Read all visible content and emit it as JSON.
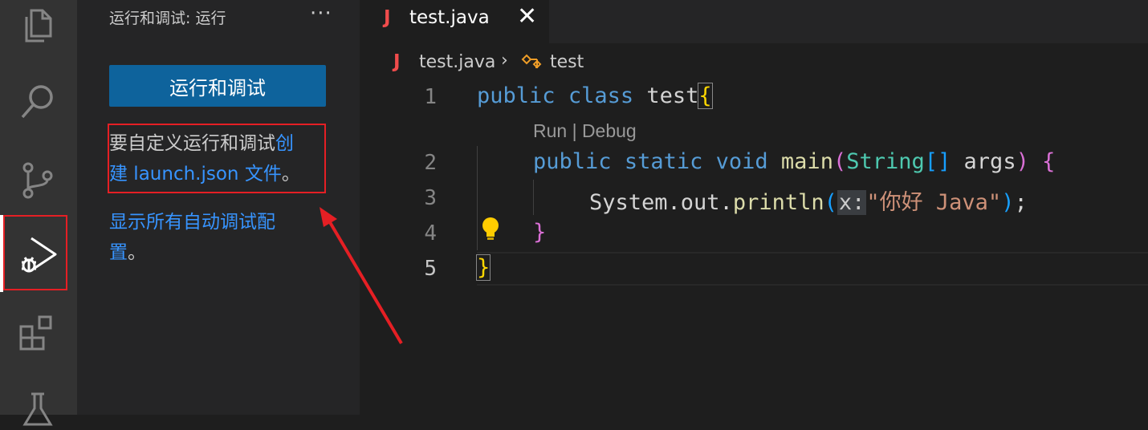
{
  "sidebar": {
    "title": "运行和调试: 运行",
    "more": "···",
    "run_button": "运行和调试",
    "hint_prefix": "要自定义运行和调试",
    "hint_link_1": "创",
    "hint_link_2": "建 launch.json 文件",
    "hint_suffix": "。",
    "show_all_line1": "显示所有自动调试配",
    "show_all_line2": "置",
    "show_all_suffix": "。"
  },
  "tabs": [
    {
      "icon": "J",
      "label": "test.java",
      "close": "✕"
    }
  ],
  "breadcrumb": {
    "icon": "J",
    "file": "test.java",
    "separator": "›",
    "class": "test"
  },
  "editor": {
    "codelens": "Run | Debug",
    "line_numbers": [
      "1",
      "2",
      "3",
      "4",
      "5"
    ],
    "line1": {
      "kw1": "public",
      "kw2": "class",
      "name": "test",
      "brace": "{"
    },
    "line2": {
      "kw1": "public",
      "kw2": "static",
      "kw3": "void",
      "fn": "main",
      "p_open": "(",
      "type": "String",
      "arr": "[]",
      "arg": "args",
      "p_close": ")",
      "brace": "{"
    },
    "line3": {
      "obj": "System.out.",
      "fn": "println",
      "p_open": "(",
      "param_hint": "x:",
      "str": "\"你好 Java\"",
      "p_close": ")",
      "semi": ";"
    },
    "line4": {
      "brace": "}"
    },
    "line5": {
      "brace": "}"
    }
  },
  "icons": {
    "activity": [
      "explorer-icon",
      "search-icon",
      "source-control-icon",
      "run-debug-icon",
      "extensions-icon",
      "testing-icon"
    ],
    "lightbulb": "lightbulb-icon"
  },
  "colors": {
    "accent": "#0e639c",
    "link": "#3794ff",
    "annotation_red": "#e51f24"
  }
}
